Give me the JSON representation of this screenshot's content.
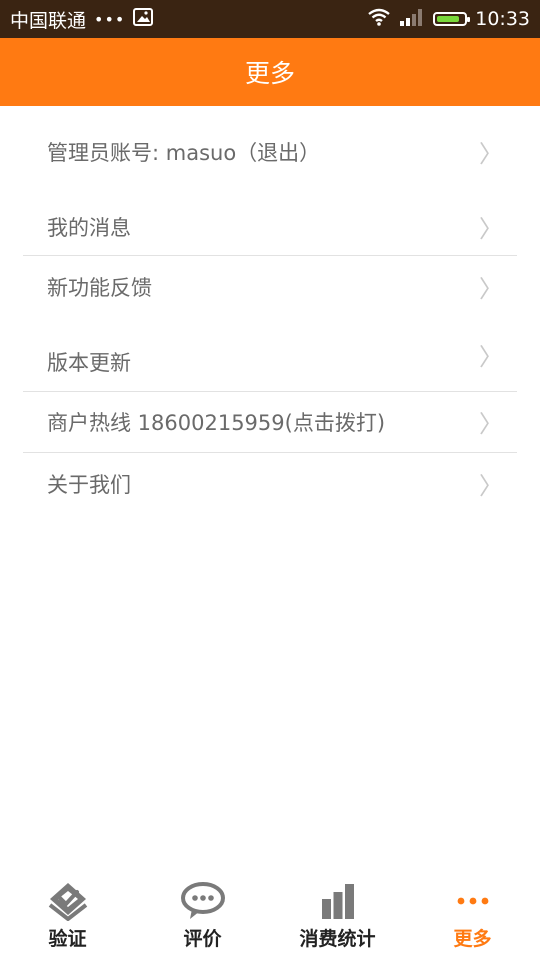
{
  "status_bar": {
    "carrier": "中国联通",
    "dots": "•••",
    "time": "10:33",
    "battery_level": 0.85
  },
  "header": {
    "title": "更多"
  },
  "menu": {
    "items": [
      {
        "label": "管理员账号: masuo（退出）"
      },
      {
        "label": "我的消息"
      },
      {
        "label": "新功能反馈"
      },
      {
        "label": "版本更新"
      },
      {
        "label": "商户热线  18600215959(点击拨打)"
      },
      {
        "label": "关于我们"
      }
    ],
    "chevron": "〉"
  },
  "bottom_nav": {
    "items": [
      {
        "label": "验证",
        "icon": "check-diamond-icon"
      },
      {
        "label": "评价",
        "icon": "chat-bubble-icon"
      },
      {
        "label": "消费统计",
        "icon": "bar-chart-icon"
      },
      {
        "label": "更多",
        "icon": "more-dots-icon"
      }
    ],
    "active_color": "#ff7a12",
    "inactive_color": "#8a8a8a"
  },
  "colors": {
    "accent": "#ff7a12",
    "status_bar": "#3a2412"
  }
}
